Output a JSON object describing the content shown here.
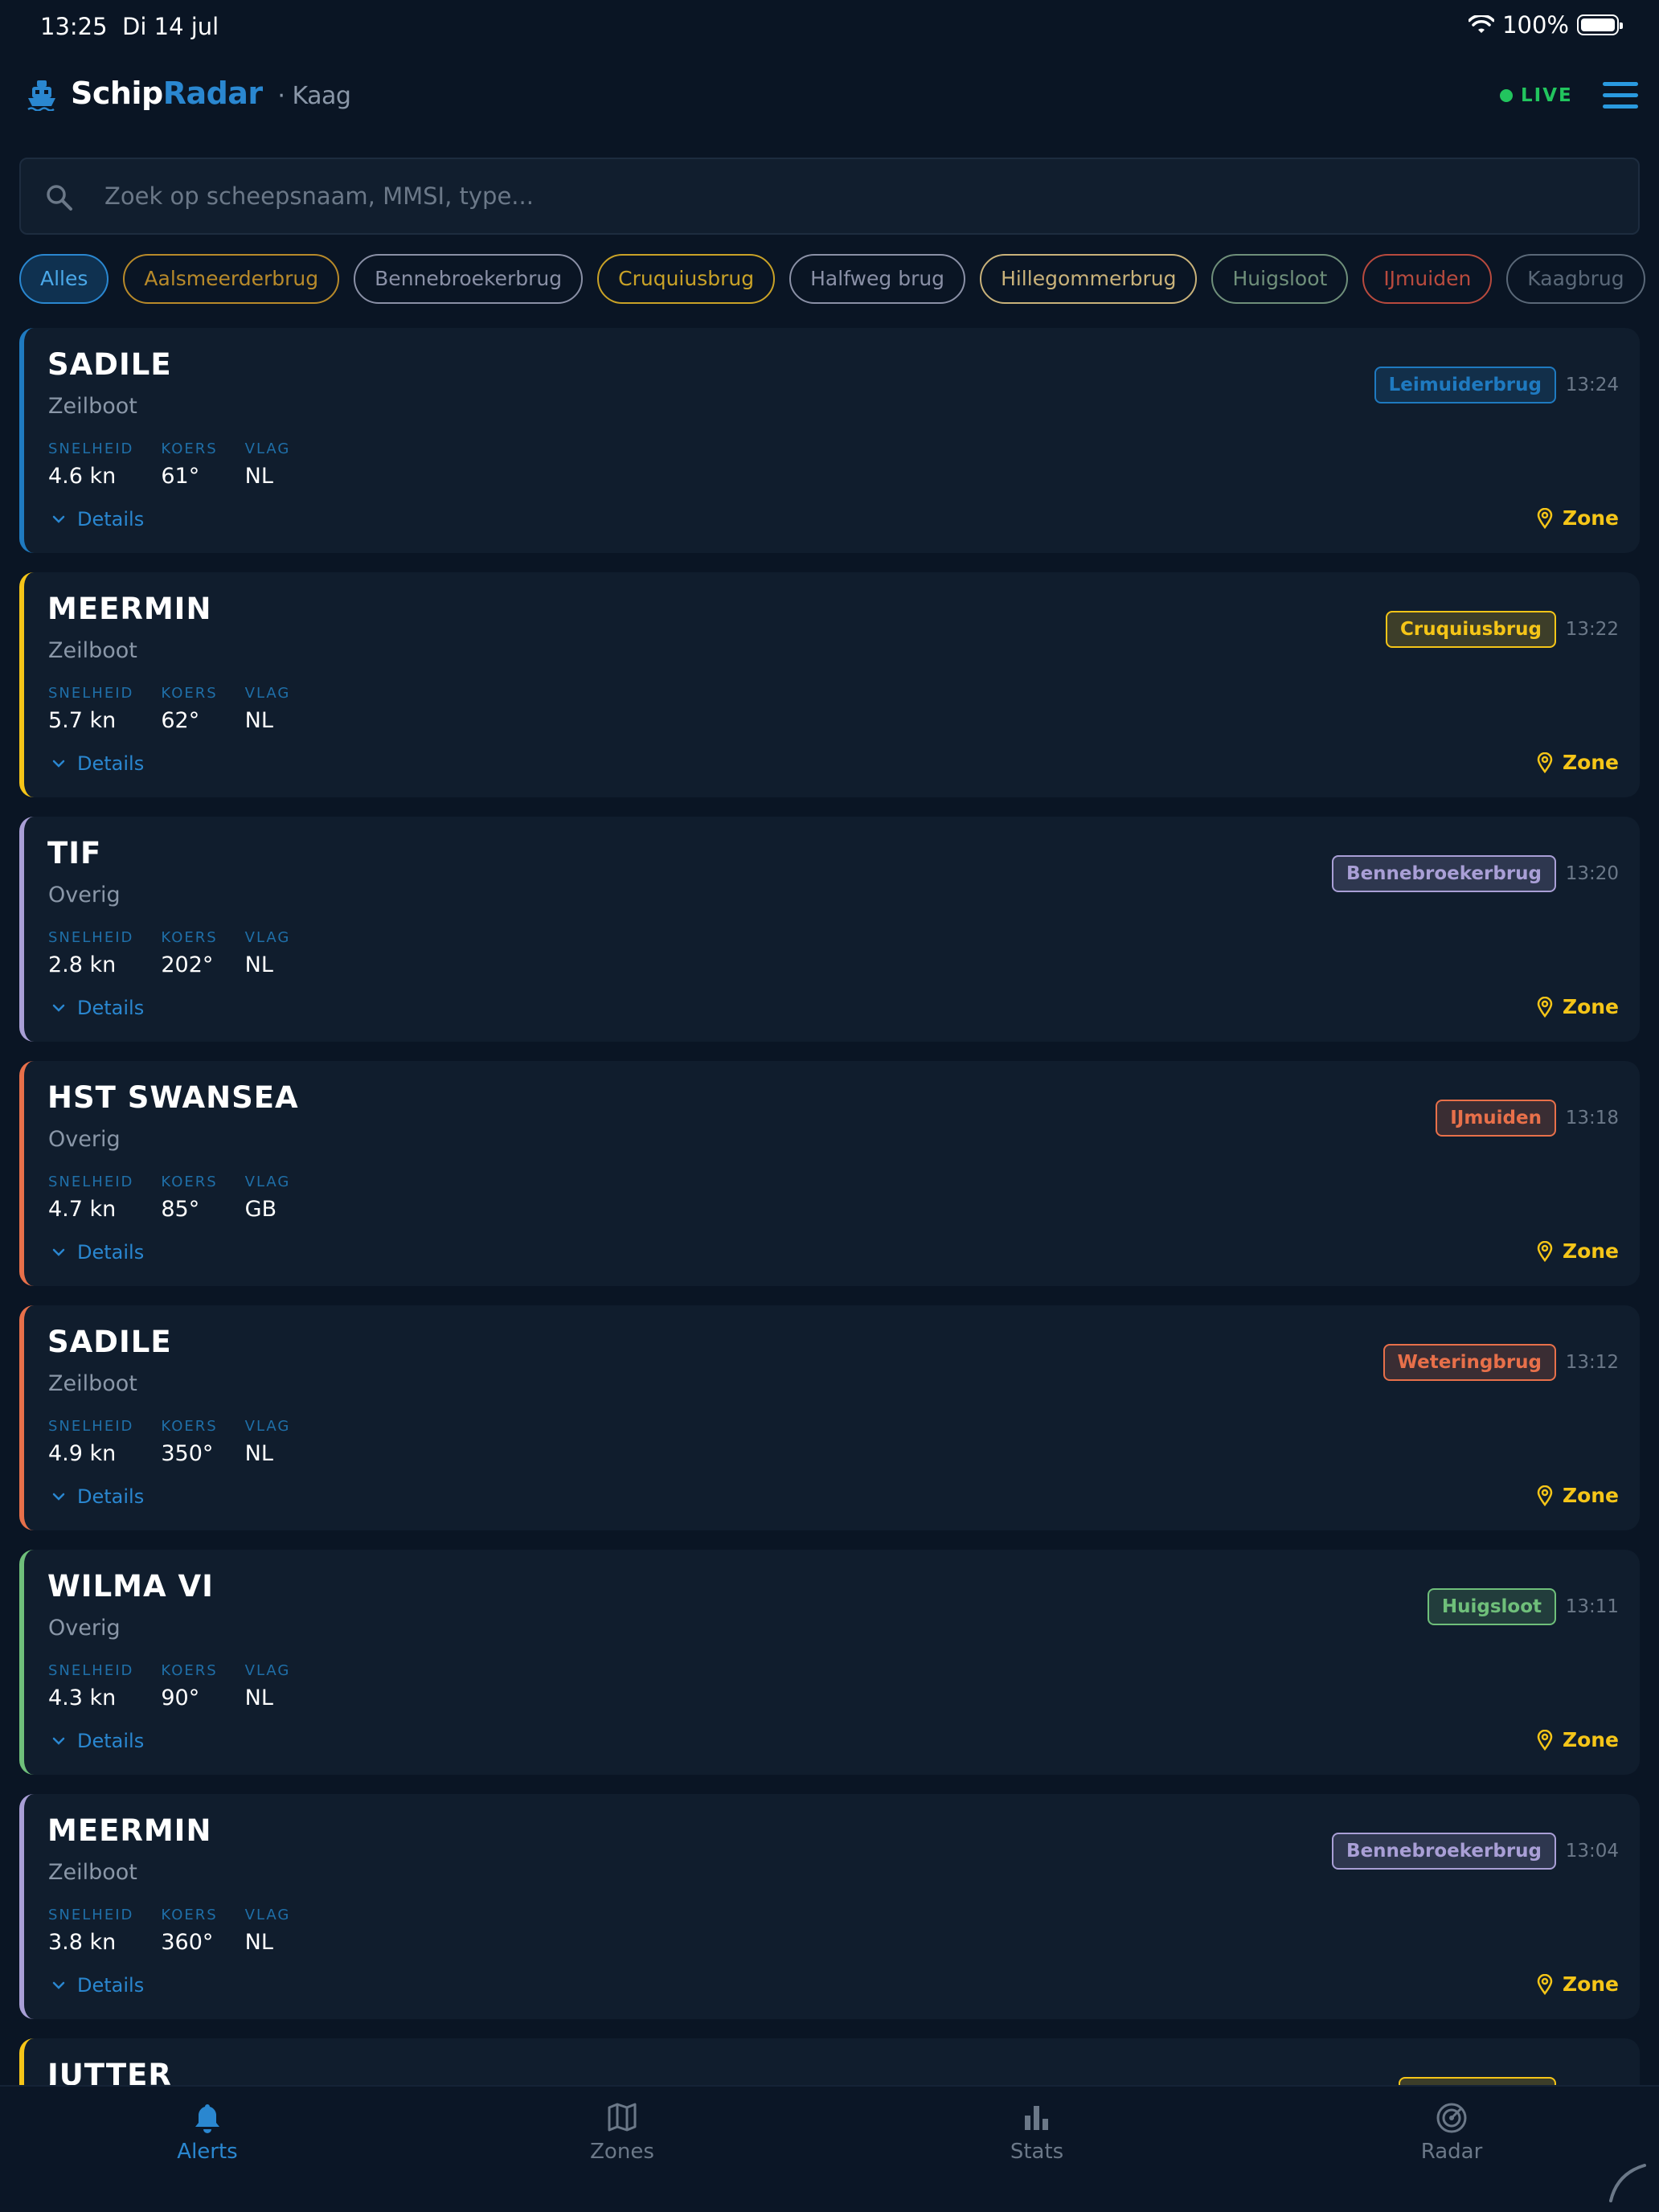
{
  "status_bar": {
    "time": "13:25",
    "date": "Di 14 jul",
    "battery": "100%"
  },
  "header": {
    "brand_part1": "Schip",
    "brand_part2": "Radar",
    "location": "· Kaag",
    "live_label": "LIVE"
  },
  "search": {
    "placeholder": "Zoek op scheepsnaam, MMSI, type..."
  },
  "filters": [
    {
      "label": "Alles",
      "active": true,
      "color": "#2a87d0"
    },
    {
      "label": "Aalsmeerderbrug",
      "color": "#b88a2a"
    },
    {
      "label": "Bennebroekerbrug",
      "color": "#8a90a6"
    },
    {
      "label": "Cruquiusbrug",
      "color": "#c9a227"
    },
    {
      "label": "Halfweg brug",
      "color": "#8a90a6"
    },
    {
      "label": "Hillegommerbrug",
      "color": "#c9b27a"
    },
    {
      "label": "Huigsloot",
      "color": "#6f8f7a"
    },
    {
      "label": "IJmuiden",
      "color": "#b84a3e"
    },
    {
      "label": "Kaagbrug",
      "color": "#5a6878"
    }
  ],
  "labels": {
    "speed": "SNELHEID",
    "course": "KOERS",
    "flag": "VLAG",
    "details": "Details",
    "zone": "Zone"
  },
  "alerts": [
    {
      "name": "SADILE",
      "type": "Zeilboot",
      "speed": "4.6 kn",
      "course": "61°",
      "flag": "NL",
      "bridge": "Leimuiderbrug",
      "time": "13:24",
      "color": "#1f7ac0"
    },
    {
      "name": "MEERMIN",
      "type": "Zeilboot",
      "speed": "5.7 kn",
      "course": "62°",
      "flag": "NL",
      "bridge": "Cruquiusbrug",
      "time": "13:22",
      "color": "#f5c518"
    },
    {
      "name": "TIF",
      "type": "Overig",
      "speed": "2.8 kn",
      "course": "202°",
      "flag": "NL",
      "bridge": "Bennebroekerbrug",
      "time": "13:20",
      "color": "#a99fd6"
    },
    {
      "name": "HST SWANSEA",
      "type": "Overig",
      "speed": "4.7 kn",
      "course": "85°",
      "flag": "GB",
      "bridge": "IJmuiden",
      "time": "13:18",
      "color": "#e8704a"
    },
    {
      "name": "SADILE",
      "type": "Zeilboot",
      "speed": "4.9 kn",
      "course": "350°",
      "flag": "NL",
      "bridge": "Weteringbrug",
      "time": "13:12",
      "color": "#e8704a"
    },
    {
      "name": "WILMA VI",
      "type": "Overig",
      "speed": "4.3 kn",
      "course": "90°",
      "flag": "NL",
      "bridge": "Huigsloot",
      "time": "13:11",
      "color": "#6fbf7a"
    },
    {
      "name": "MEERMIN",
      "type": "Zeilboot",
      "speed": "3.8 kn",
      "course": "360°",
      "flag": "NL",
      "bridge": "Bennebroekerbrug",
      "time": "13:04",
      "color": "#a99fd6"
    },
    {
      "name": "JUTTER",
      "type": "",
      "speed": "",
      "course": "",
      "flag": "",
      "bridge": "",
      "time": "",
      "color": "#f5c518"
    }
  ],
  "tabs": [
    {
      "label": "Alerts",
      "icon": "bell-icon",
      "active": true
    },
    {
      "label": "Zones",
      "icon": "map-icon"
    },
    {
      "label": "Stats",
      "icon": "bar-chart-icon"
    },
    {
      "label": "Radar",
      "icon": "radar-icon"
    }
  ]
}
